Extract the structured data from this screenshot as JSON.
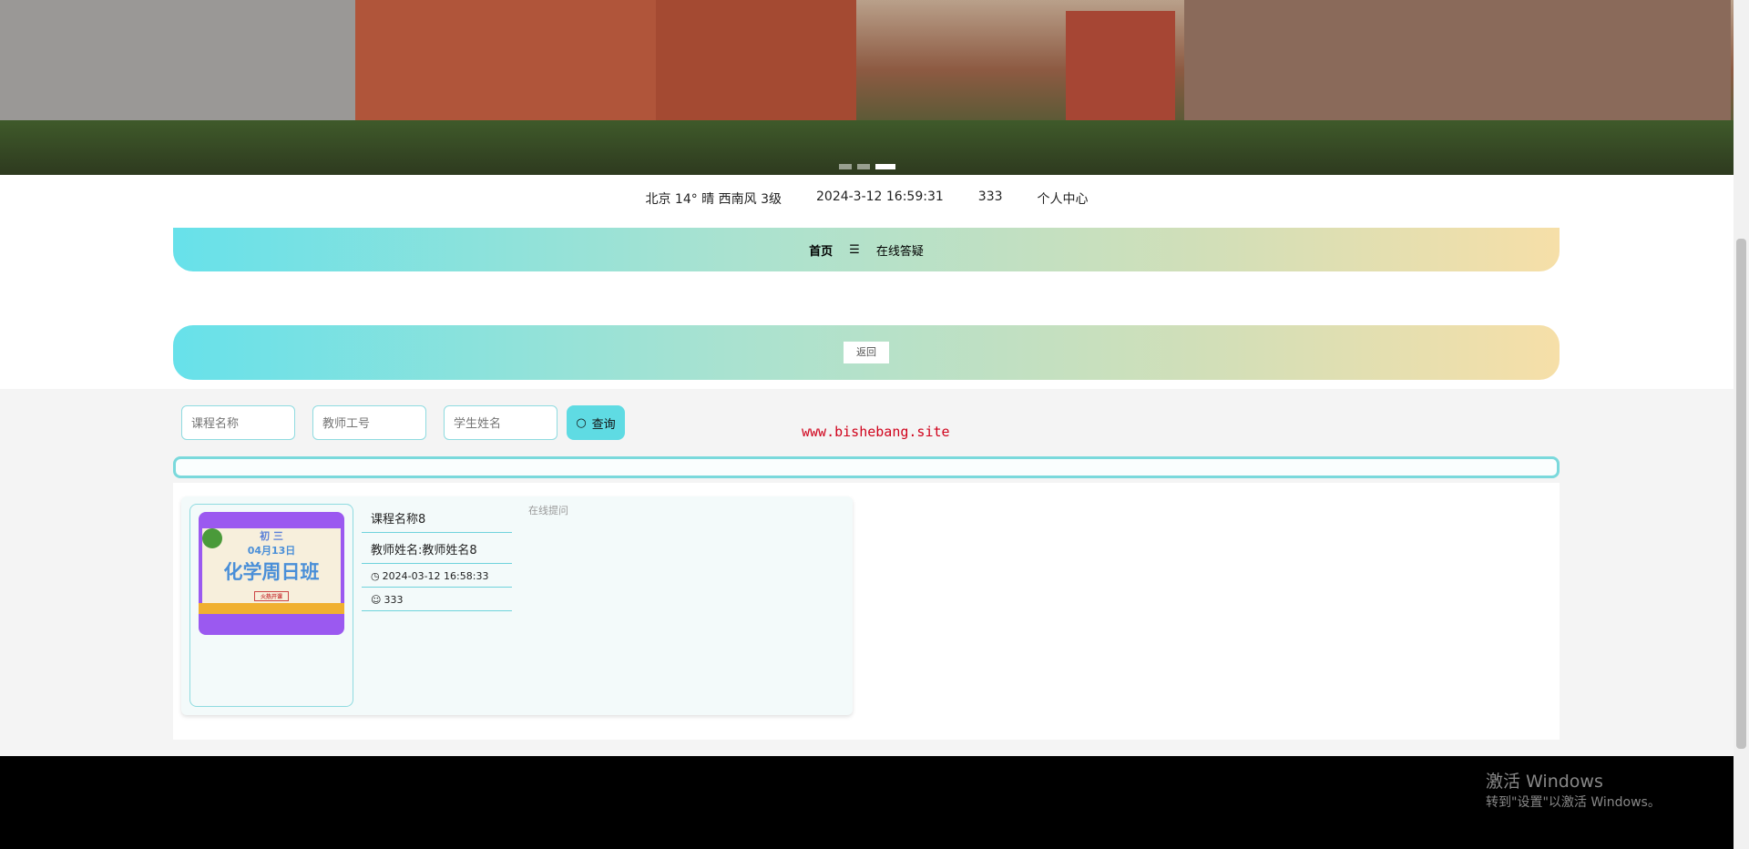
{
  "info": {
    "weather": "北京  14°  晴  西南风  3级",
    "datetime": "2024-3-12 16:59:31",
    "user": "333",
    "profile": "个人中心"
  },
  "nav": {
    "home": "首页",
    "separator": "☰",
    "current": "在线答疑"
  },
  "back_label": "返回",
  "search": {
    "course_placeholder": "课程名称",
    "teacher_id_placeholder": "教师工号",
    "student_placeholder": "学生姓名",
    "button": "查询"
  },
  "watermark": "www.bishebang.site",
  "card": {
    "course": "课程名称8",
    "teacher": "教师姓名:教师姓名8",
    "time": "2024-03-12 16:58:33",
    "user": "333",
    "ask": "在线提问",
    "poster": {
      "grade": "初 三",
      "date": "04月13日",
      "title": "化学周日班",
      "tag": "火热开课"
    }
  },
  "windows": {
    "line1": "激活 Windows",
    "line2": "转到\"设置\"以激活 Windows。"
  },
  "colors": {
    "accent": "#5fdbe3",
    "watermark": "#d0021b"
  }
}
